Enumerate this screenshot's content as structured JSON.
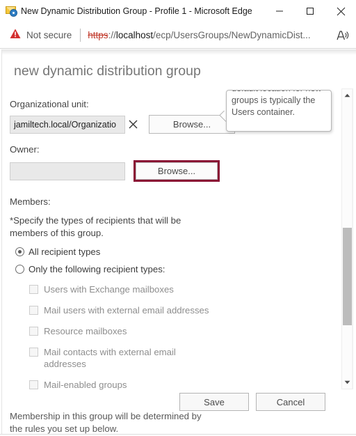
{
  "window": {
    "icon": "exchange-admin-envelope-gear-icon",
    "title": "New Dynamic Distribution Group - Profile 1 - Microsoft Edge",
    "controls": {
      "minimize": "minimize-icon",
      "maximize": "maximize-icon",
      "close": "close-icon"
    }
  },
  "address_bar": {
    "security_icon": "warning-triangle-icon",
    "security_label": "Not secure",
    "url_scheme": "https",
    "url_separator": "://",
    "url_host": "localhost",
    "url_path": "/ecp/UsersGroups/NewDynamicDist...",
    "read_aloud_icon": "read-aloud-icon"
  },
  "dialog": {
    "title": "new dynamic distribution group",
    "org_unit": {
      "label": "Organizational unit:",
      "value": "jamiltech.local/Organizatio",
      "clear_icon": "clear-x-icon",
      "browse_label": "Browse..."
    },
    "owner": {
      "label": "Owner:",
      "value": "",
      "browse_label": "Browse...",
      "highlight_color": "#8a1134"
    },
    "members": {
      "label": "Members:",
      "instruction": "*Specify the types of recipients that will be members of this group.",
      "radios": [
        {
          "label": "All recipient types",
          "selected": true
        },
        {
          "label": "Only the following recipient types:",
          "selected": false
        }
      ],
      "checkboxes": [
        {
          "label": "Users with Exchange mailboxes",
          "checked": false
        },
        {
          "label": "Mail users with external email addresses",
          "checked": false
        },
        {
          "label": "Resource mailboxes",
          "checked": false
        },
        {
          "label": "Mail contacts with external email addresses",
          "checked": false
        },
        {
          "label": "Mail-enabled groups",
          "checked": false
        }
      ],
      "membership_note": "Membership in this group will be determined by the rules you set up below."
    },
    "footer": {
      "save_label": "Save",
      "cancel_label": "Cancel"
    }
  },
  "tooltip": {
    "text": "default location for new groups is typically the Users container."
  },
  "scrollbar": {
    "up_icon": "scroll-up-arrow-icon",
    "down_icon": "scroll-down-arrow-icon",
    "thumb": "scrollbar-thumb"
  }
}
